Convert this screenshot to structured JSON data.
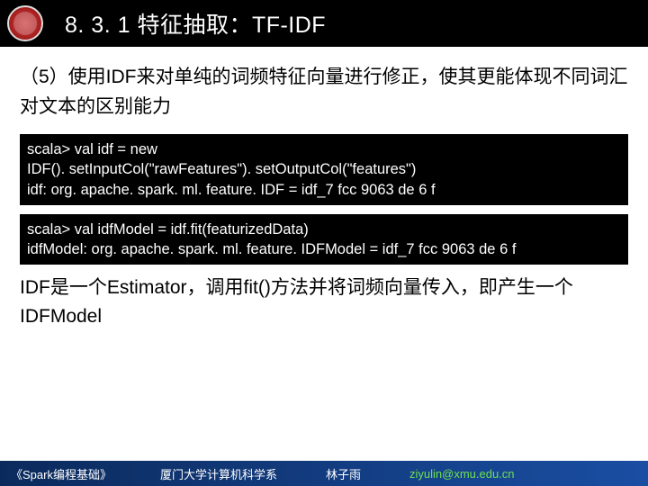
{
  "header": {
    "title": "8. 3. 1 特征抽取：TF-IDF"
  },
  "intro": "（5）使用IDF来对单纯的词频特征向量进行修正，使其更能体现不同词汇对文本的区别能力",
  "code1": "scala> val idf = new\nIDF(). setInputCol(\"rawFeatures\"). setOutputCol(\"features\")\nidf: org. apache. spark. ml. feature. IDF = idf_7 fcc 9063 de 6 f",
  "code2": "scala> val idfModel = idf.fit(featurizedData)\nidfModel: org. apache. spark. ml. feature. IDFModel = idf_7 fcc 9063 de 6 f",
  "explain": "IDF是一个Estimator，调用fit()方法并将词频向量传入，即产生一个IDFModel",
  "footer": {
    "book": "《Spark编程基础》",
    "dept": "厦门大学计算机科学系",
    "author": "林子雨",
    "email": "ziyulin@xmu.edu.cn"
  }
}
